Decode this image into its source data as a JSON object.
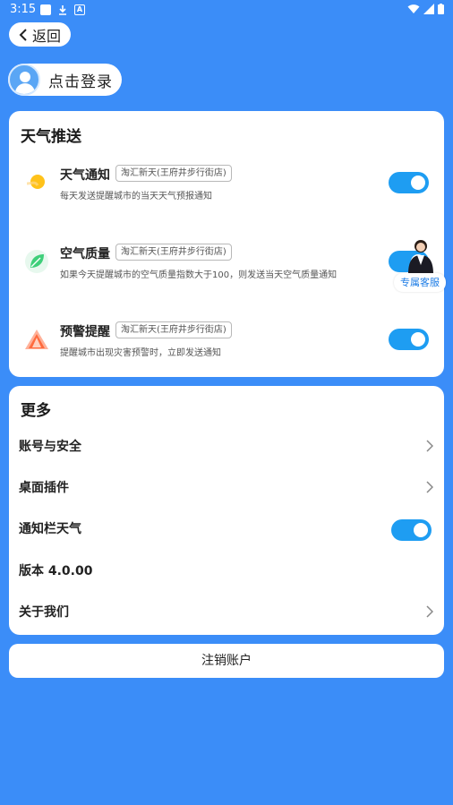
{
  "status_bar": {
    "time": "3:15"
  },
  "back": {
    "label": "返回"
  },
  "login": {
    "label": "点击登录"
  },
  "push": {
    "title": "天气推送",
    "items": [
      {
        "name": "天气通知",
        "tag": "淘汇新天(王府井步行街店)",
        "desc": "每天发送提醒城市的当天天气预报通知",
        "enabled": true,
        "icon": "sun-icon"
      },
      {
        "name": "空气质量",
        "tag": "淘汇新天(王府井步行街店)",
        "desc": "如果今天提醒城市的空气质量指数大于100，则发送当天空气质量通知",
        "enabled": true,
        "icon": "leaf-icon"
      },
      {
        "name": "预警提醒",
        "tag": "淘汇新天(王府井步行街店)",
        "desc": "提醒城市出现灾害预警时，立即发送通知",
        "enabled": true,
        "icon": "warning-icon"
      }
    ]
  },
  "service": {
    "label": "专属客服"
  },
  "more": {
    "title": "更多",
    "items": [
      {
        "label": "账号与安全"
      },
      {
        "label": "桌面插件"
      },
      {
        "label": "通知栏天气",
        "enabled": true
      },
      {
        "label": "版本 4.0.00"
      },
      {
        "label": "关于我们"
      }
    ]
  },
  "cancel": {
    "label": "注销账户"
  },
  "colors": {
    "background": "#3b8df8",
    "toggle_on": "#1e9df2",
    "service_text": "#1e7de6"
  }
}
